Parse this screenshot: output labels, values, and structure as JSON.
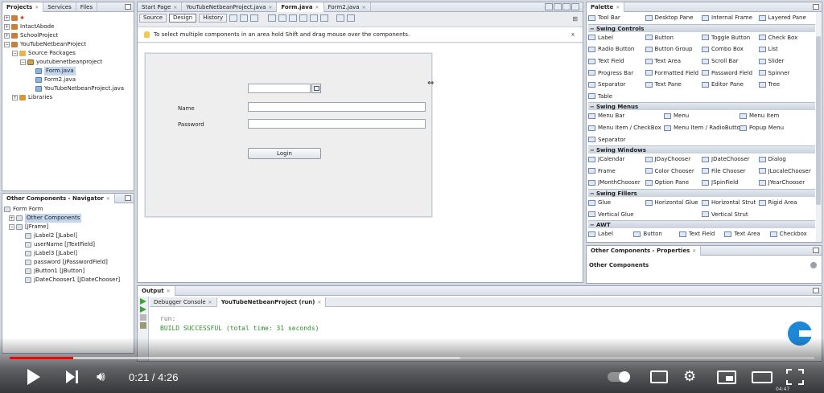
{
  "projects_panel": {
    "tabs": [
      {
        "label": "Projects"
      },
      {
        "label": "Services"
      },
      {
        "label": "Files"
      }
    ],
    "tree": [
      {
        "label": "",
        "level": 0,
        "type": "cup"
      },
      {
        "label": "IntactAbode",
        "level": 0,
        "type": "cup"
      },
      {
        "label": "SchoolProject",
        "level": 0,
        "type": "cup"
      },
      {
        "label": "YouTubeNetbeanProject",
        "level": 0,
        "type": "cup"
      },
      {
        "label": "Source Packages",
        "level": 1,
        "type": "folder"
      },
      {
        "label": "youtubenetbeanproject",
        "level": 2,
        "type": "pkg"
      },
      {
        "label": "Form.java",
        "level": 3,
        "type": "jfile",
        "selected": true
      },
      {
        "label": "Form2.java",
        "level": 3,
        "type": "jfile"
      },
      {
        "label": "YouTubeNetbeanProject.java",
        "level": 3,
        "type": "jfile"
      },
      {
        "label": "Libraries",
        "level": 1,
        "type": "lib"
      }
    ]
  },
  "navigator": {
    "title": "Other Components - Navigator",
    "tree": [
      {
        "label": "Form Form",
        "level": 0
      },
      {
        "label": "Other Components",
        "level": 1,
        "selected": true
      },
      {
        "label": "[JFrame]",
        "level": 1
      },
      {
        "label": "jLabel2 [JLabel]",
        "level": 2
      },
      {
        "label": "userName [JTextField]",
        "level": 2
      },
      {
        "label": "jLabel3 [JLabel]",
        "level": 2
      },
      {
        "label": "password [JPasswordField]",
        "level": 2
      },
      {
        "label": "jButton1 [JButton]",
        "level": 2
      },
      {
        "label": "jDateChooser1 [JDateChooser]",
        "level": 2
      }
    ]
  },
  "editor": {
    "tabs": [
      {
        "label": "Start Page"
      },
      {
        "label": "YouTubeNetbeanProject.java"
      },
      {
        "label": "Form.java",
        "active": true
      },
      {
        "label": "Form2.java"
      }
    ],
    "modes": [
      "Source",
      "Design",
      "History"
    ],
    "active_mode": "Design",
    "hint": "To select multiple components in an area hold Shift and drag mouse over the components.",
    "form": {
      "name_label": "Name",
      "password_label": "Password",
      "login_button": "Login"
    }
  },
  "palette": {
    "title": "Palette",
    "top_row": [
      "Tool Bar",
      "Desktop Pane",
      "Internal Frame",
      "Layered Pane"
    ],
    "sections": [
      {
        "title": "Swing Controls",
        "rows": [
          [
            "Label",
            "Button",
            "Toggle Button",
            "Check Box"
          ],
          [
            "Radio Button",
            "Button Group",
            "Combo Box",
            "List"
          ],
          [
            "Text Field",
            "Text Area",
            "Scroll Bar",
            "Slider"
          ],
          [
            "Progress Bar",
            "Formatted Field",
            "Password Field",
            "Spinner"
          ],
          [
            "Separator",
            "Text Pane",
            "Editor Pane",
            "Tree"
          ],
          [
            "Table"
          ]
        ]
      },
      {
        "title": "Swing Menus",
        "rows": [
          [
            "Menu Bar",
            "Menu",
            "Menu Item"
          ],
          [
            "Menu Item / CheckBox",
            "Menu Item / RadioButton",
            "Popup Menu"
          ],
          [
            "Separator"
          ]
        ]
      },
      {
        "title": "Swing Windows",
        "rows": [
          [
            "JCalendar",
            "JDayChooser",
            "JDateChooser",
            "Dialog"
          ],
          [
            "Frame",
            "Color Chooser",
            "File Chooser",
            "JLocaleChooser"
          ],
          [
            "JMonthChooser",
            "Option Pane",
            "JSpinField",
            "JYearChooser"
          ]
        ]
      },
      {
        "title": "Swing Fillers",
        "rows": [
          [
            "Glue",
            "Horizontal Glue",
            "Horizontal Strut",
            "Rigid Area"
          ],
          [
            "Vertical Glue",
            "Vertical Strut"
          ]
        ]
      },
      {
        "title": "AWT",
        "rows": [
          [
            "Label",
            "Button",
            "Text Field",
            "Text Area",
            "Checkbox"
          ]
        ]
      }
    ]
  },
  "properties": {
    "title": "Other Components - Properties",
    "heading": "Other Components"
  },
  "output": {
    "title": "Output",
    "tabs": [
      {
        "label": "Debugger Console"
      },
      {
        "label": "YouTubeNetbeanProject (run)",
        "active": true
      }
    ],
    "lines": [
      "run:",
      "BUILD SUCCESSFUL (total time: 31 seconds)"
    ]
  },
  "video_player": {
    "time_current": "0:21",
    "time_total": "4:26",
    "progress_played": 0.079,
    "progress_buffered": 0.56,
    "clock": "04:47"
  },
  "colors": {
    "accent": "#ff0000",
    "build_text": "#2e8b2e",
    "selection": "#c3d6ee"
  }
}
